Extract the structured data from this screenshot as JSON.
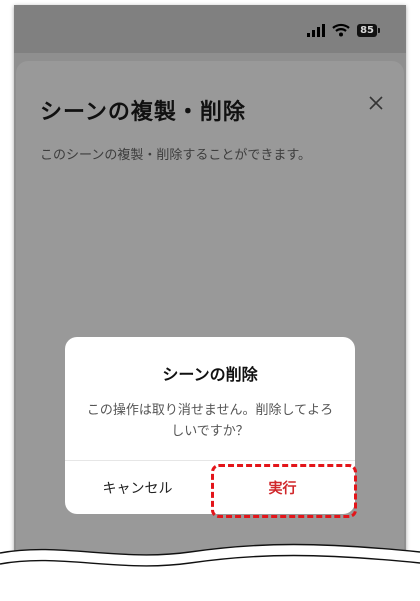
{
  "status_bar": {
    "battery_level": "85",
    "icons": [
      "signal-icon",
      "wifi-icon",
      "battery-icon"
    ]
  },
  "sheet": {
    "title": "シーンの複製・削除",
    "description": "このシーンの複製・削除することができます。",
    "close_icon": "close-icon"
  },
  "dialog": {
    "title": "シーンの削除",
    "message": "この操作は取り消せません。削除してよろしいですか？",
    "cancel_label": "キャンセル",
    "execute_label": "実行"
  },
  "colors": {
    "overlay": "#999999",
    "accent_red": "#d0272b",
    "highlight": "#e3151a"
  }
}
